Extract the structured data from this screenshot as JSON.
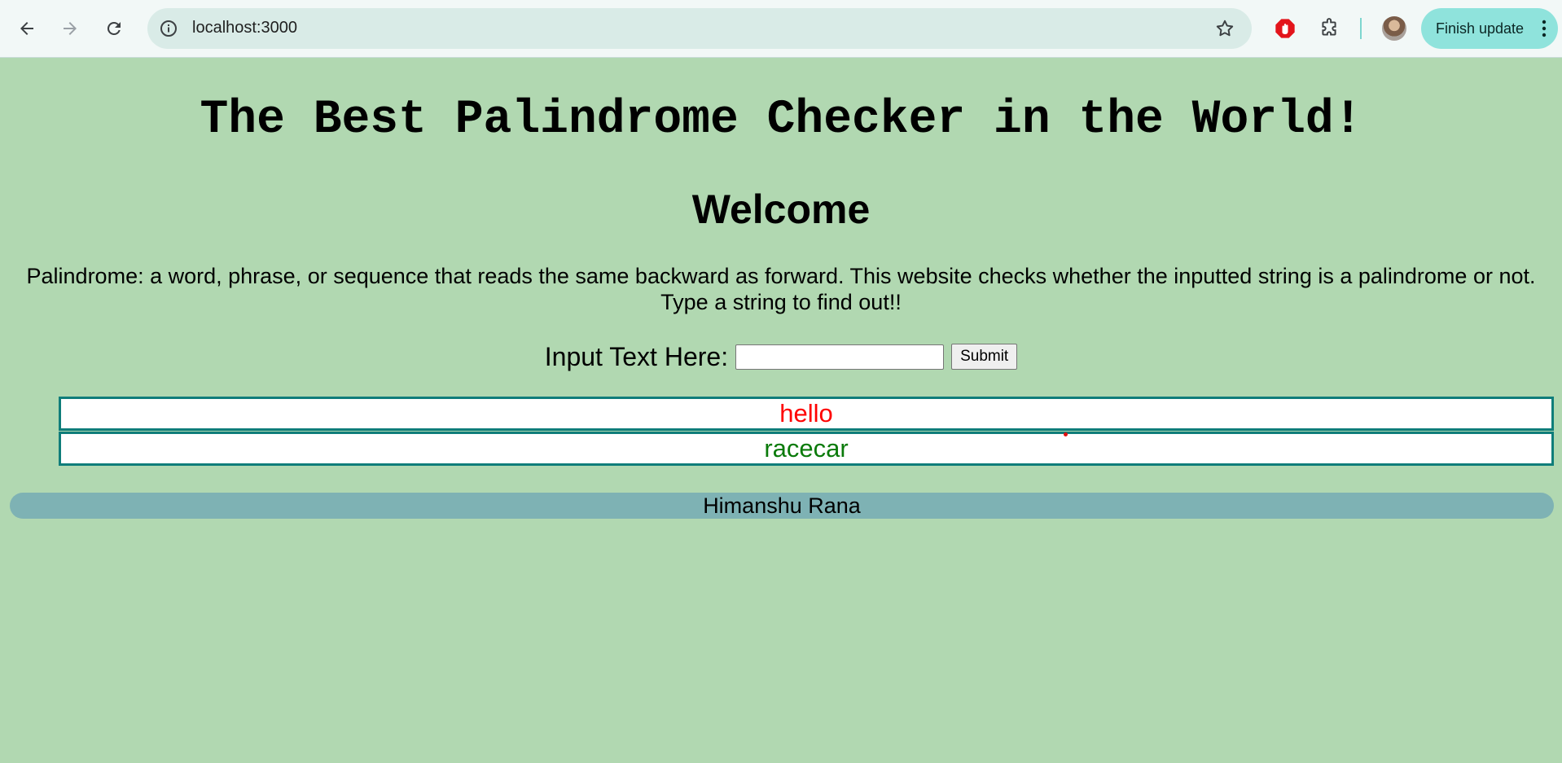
{
  "browser": {
    "url": "localhost:3000",
    "update_button_label": "Finish update",
    "icons": [
      "back-arrow-icon",
      "forward-arrow-icon",
      "reload-icon",
      "info-icon",
      "star-icon",
      "adblock-extension-icon",
      "puzzle-extension-icon",
      "kebab-menu-icon"
    ]
  },
  "page": {
    "title": "The Best Palindrome Checker in the World!",
    "welcome": "Welcome",
    "description": "Palindrome: a word, phrase, or sequence that reads the same backward as forward. This website checks whether the inputted string is a palindrome or not. Type a string to find out!!",
    "form": {
      "label": "Input Text Here:",
      "input_value": "",
      "submit_label": "Submit"
    },
    "results": [
      {
        "text": "hello",
        "color": "#ff0000"
      },
      {
        "text": "racecar",
        "color": "#0a7a0a"
      }
    ],
    "footer": "Himanshu Rana"
  },
  "colors": {
    "page_background": "#b1d8b1",
    "result_border": "#0f7d7a",
    "footer_background": "#7eb2b4"
  }
}
